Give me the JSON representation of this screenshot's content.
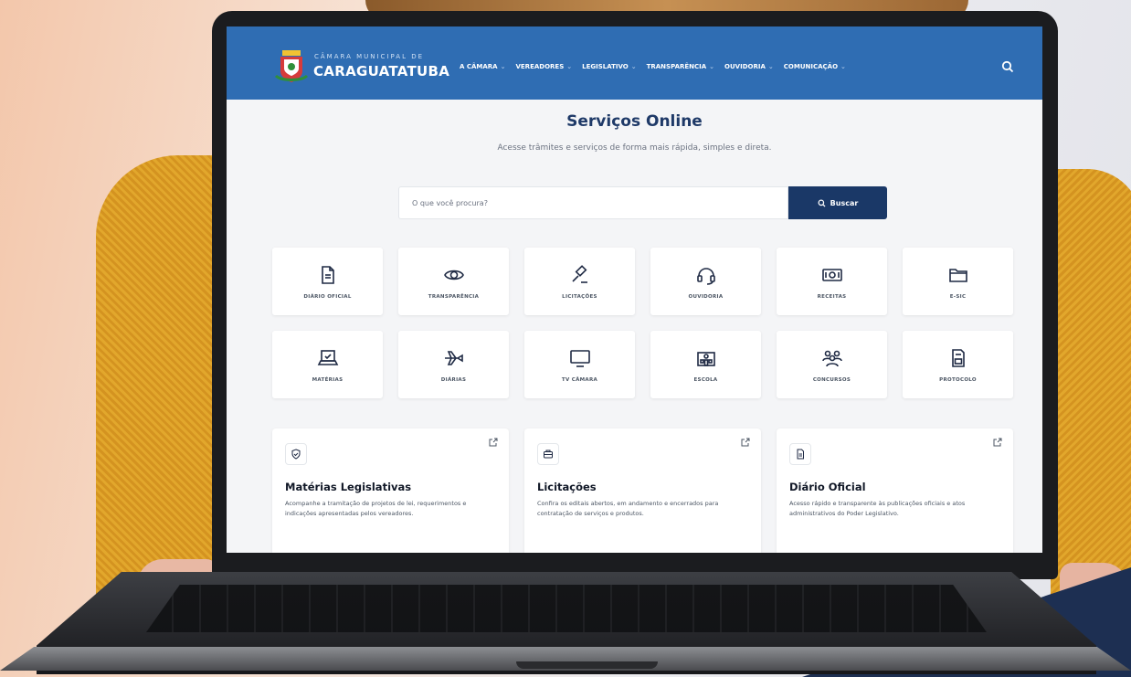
{
  "header": {
    "brand_small": "CÂMARA MUNICIPAL DE",
    "brand_big": "CARAGUATATUBA",
    "nav": [
      {
        "label": "A CÂMARA"
      },
      {
        "label": "VEREADORES"
      },
      {
        "label": "LEGISLATIVO"
      },
      {
        "label": "TRANSPARÊNCIA"
      },
      {
        "label": "OUVIDORIA"
      },
      {
        "label": "COMUNICAÇÃO"
      }
    ],
    "search_icon": "search-icon"
  },
  "main": {
    "title": "Serviços Online",
    "subtitle": "Acesse trâmites e serviços de forma mais rápida, simples e direta.",
    "search": {
      "placeholder": "O que você procura?",
      "button": "Buscar"
    }
  },
  "tiles": [
    {
      "label": "DIÁRIO OFICIAL",
      "icon": "document-icon"
    },
    {
      "label": "TRANSPARÊNCIA",
      "icon": "eye-icon"
    },
    {
      "label": "LICITAÇÕES",
      "icon": "gavel-icon"
    },
    {
      "label": "OUVIDORIA",
      "icon": "headset-icon"
    },
    {
      "label": "RECEITAS",
      "icon": "money-icon"
    },
    {
      "label": "E-SIC",
      "icon": "folder-icon"
    },
    {
      "label": "MATÉRIAS",
      "icon": "laptop-check-icon"
    },
    {
      "label": "DIÁRIAS",
      "icon": "airplane-icon"
    },
    {
      "label": "TV CÂMARA",
      "icon": "tv-icon"
    },
    {
      "label": "ESCOLA",
      "icon": "school-icon"
    },
    {
      "label": "CONCURSOS",
      "icon": "people-icon"
    },
    {
      "label": "PROTOCOLO",
      "icon": "protocol-icon"
    }
  ],
  "cards": [
    {
      "title": "Matérias Legislativas",
      "text": "Acompanhe a tramitação de projetos de lei, requerimentos e indicações apresentadas pelos vereadores.",
      "icon": "shield-check-icon"
    },
    {
      "title": "Licitações",
      "text": "Confira os editais abertos, em andamento e encerrados para contratação de serviços e produtos.",
      "icon": "briefcase-icon"
    },
    {
      "title": "Diário Oficial",
      "text": "Acesso rápido e transparente às publicações oficiais e atos administrativos do Poder Legislativo.",
      "icon": "document-icon"
    }
  ],
  "colors": {
    "header": "#2f6db3",
    "button": "#1a3867",
    "title": "#1f3a68"
  }
}
